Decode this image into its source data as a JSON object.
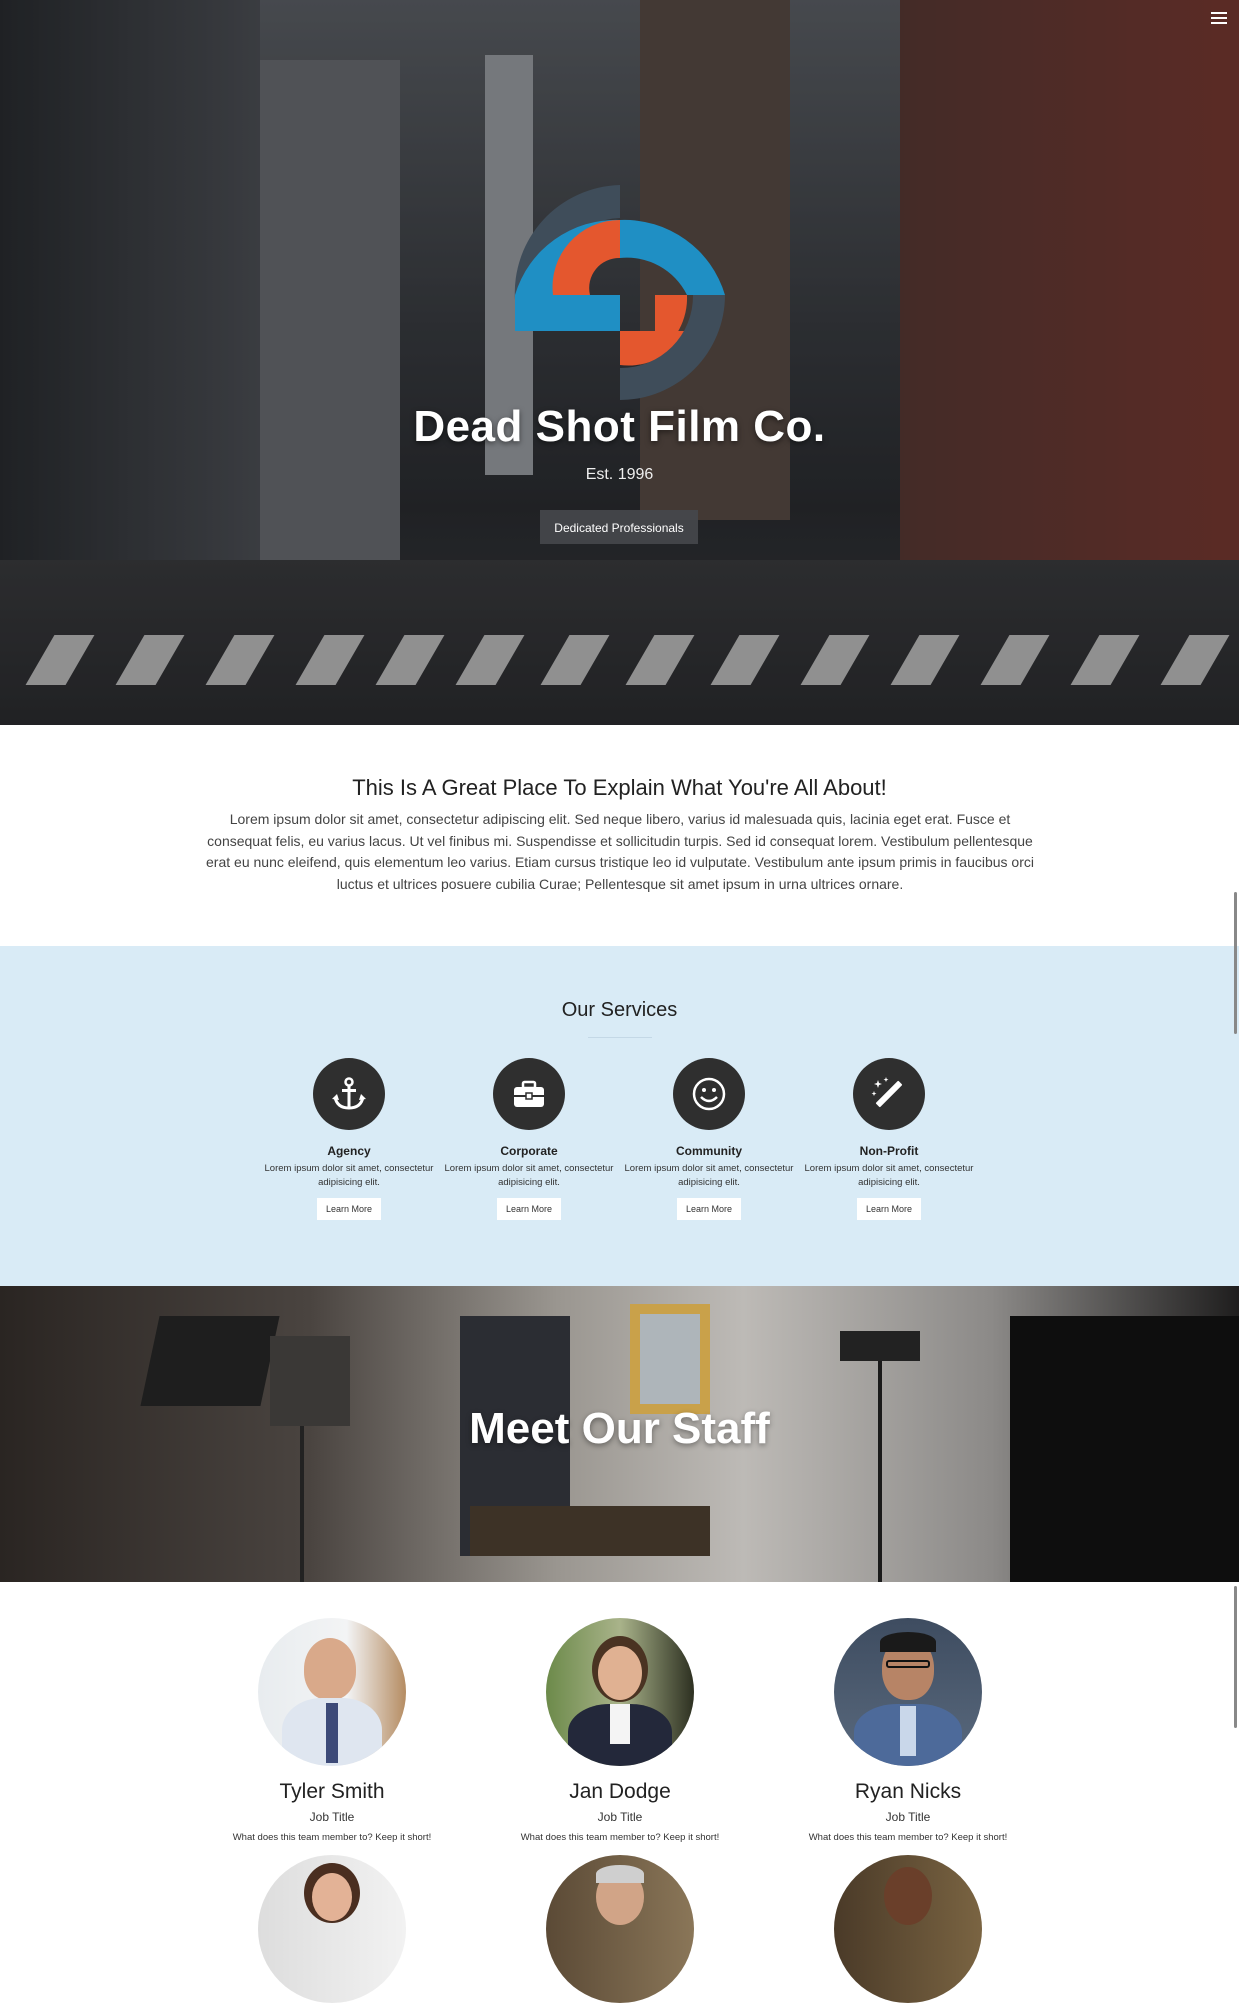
{
  "hero": {
    "title": "Dead Shot Film Co.",
    "established": "Est. 1996",
    "button_label": "Dedicated Professionals"
  },
  "about": {
    "heading": "This Is A Great Place To Explain What You're All About!",
    "body": "Lorem ipsum dolor sit amet, consectetur adipiscing elit. Sed neque libero, varius id malesuada quis, lacinia eget erat. Fusce et consequat felis, eu varius lacus. Ut vel finibus mi. Suspendisse et sollicitudin turpis. Sed id consequat lorem. Vestibulum pellentesque erat eu nunc eleifend, quis elementum leo varius. Etiam cursus tristique leo id vulputate. Vestibulum ante ipsum primis in faucibus orci luctus et ultrices posuere cubilia Curae; Pellentesque sit amet ipsum in urna ultrices ornare."
  },
  "services": {
    "heading": "Our Services",
    "items": [
      {
        "title": "Agency",
        "text": "Lorem ipsum dolor sit amet, consectetur adipisicing elit.",
        "button": "Learn More",
        "icon": "anchor-icon"
      },
      {
        "title": "Corporate",
        "text": "Lorem ipsum dolor sit amet, consectetur adipisicing elit.",
        "button": "Learn More",
        "icon": "briefcase-icon"
      },
      {
        "title": "Community",
        "text": "Lorem ipsum dolor sit amet, consectetur adipisicing elit.",
        "button": "Learn More",
        "icon": "smiley-icon"
      },
      {
        "title": "Non-Profit",
        "text": "Lorem ipsum dolor sit amet, consectetur adipisicing elit.",
        "button": "Learn More",
        "icon": "magic-wand-icon"
      }
    ]
  },
  "staff": {
    "heading": "Meet Our Staff",
    "members": [
      {
        "name": "Tyler Smith",
        "job": "Job Title",
        "desc": "What does this team member to? Keep it short!"
      },
      {
        "name": "Jan Dodge",
        "job": "Job Title",
        "desc": "What does this team member to? Keep it short!"
      },
      {
        "name": "Ryan Nicks",
        "job": "Job Title",
        "desc": "What does this team member to? Keep it short!"
      }
    ]
  },
  "colors": {
    "services_bg": "#d9ebf6",
    "logo_blue": "#1f8fc4",
    "logo_orange": "#e4572e",
    "logo_slate": "#3f4d5a"
  }
}
